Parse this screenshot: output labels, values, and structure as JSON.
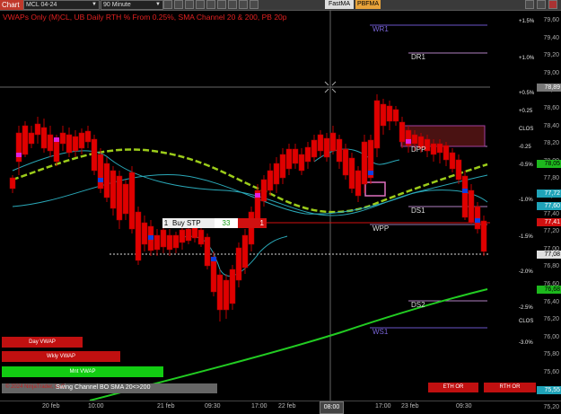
{
  "toolbar": {
    "tab_label": "Chart",
    "symbol": "MCL 04-24",
    "interval": "90 Minute",
    "fastma_label": "FastMA",
    "pbfma_label": "PBFMA"
  },
  "chart_title": "VWAPs Only (M)CL, UB Daily RTH % From 0.25%, SMA Channel 20 & 200, PB 20p",
  "levels": {
    "wr1": "WR1",
    "dr1": "DR1",
    "dpp": "DPP",
    "ds1": "DS1",
    "wpp": "WPP",
    "ds2": "DS2",
    "ws1": "WS1"
  },
  "axis": {
    "price_ticks": [
      "79,60",
      "79,40",
      "79,20",
      "79,00",
      "78,80",
      "78,60",
      "78,40",
      "78,20",
      "78,00",
      "77,80",
      "77,60",
      "77,40",
      "77,20",
      "77,00",
      "76,80",
      "76,60",
      "76,40",
      "76,20",
      "76,00",
      "75,80",
      "75,60",
      "75,40",
      "75,20"
    ],
    "pct_ticks": [
      "+1.5%",
      "+1.0%",
      "+0.5%",
      "+0.25",
      "CLOS",
      "-0.25",
      "-0.5%",
      "-1.0%",
      "-1.5%",
      "-2.0%",
      "-2.5%",
      "CLOS",
      "-3.0%"
    ],
    "price_labels": [
      {
        "text": "78,89",
        "bg": "#777777",
        "color": "#ffffff"
      },
      {
        "text": "78,05",
        "bg": "#1db81d",
        "color": "#000000"
      },
      {
        "text": "77,72",
        "bg": "#1fa3b8",
        "color": "#ffffff"
      },
      {
        "text": "77,60",
        "bg": "#1fa3b8",
        "color": "#ffffff"
      },
      {
        "text": "77,41",
        "bg": "#d01010",
        "color": "#ffffff"
      },
      {
        "text": "77,08",
        "bg": "#e0e0e0",
        "color": "#000000"
      },
      {
        "text": "76,68",
        "bg": "#1db81d",
        "color": "#000000"
      },
      {
        "text": "75,55",
        "bg": "#1fa3b8",
        "color": "#ffffff"
      }
    ],
    "time_ticks": [
      "20 feb",
      "10:00",
      "21 feb",
      "09:30",
      "17:00",
      "22 feb",
      "08:00",
      "17:00",
      "23 feb",
      "09:30"
    ],
    "time_selected": "08:00"
  },
  "order": {
    "qty_badge": "1",
    "label": "Buy STP",
    "quantity": "33",
    "close_qty": "1"
  },
  "vwap_labels": {
    "day": "Day VWAP",
    "week": "Wkly VWAP",
    "month": "Mnt VWAP"
  },
  "bottom_bar": {
    "swing_text": "Swing Channel BO SMA 20<>200",
    "copyright": "© 2024 NinjaTrader, LLC"
  },
  "buttons": {
    "eth_or": "ETH OR",
    "rth_or": "RTH OR"
  },
  "colors": {
    "bull": "#e0e0e0",
    "bear": "#e00000",
    "sma20": "#2aa8b8",
    "sma200": "#9ccc1a",
    "vwap_green": "#22cc22",
    "buy_stp": "#d01010"
  }
}
